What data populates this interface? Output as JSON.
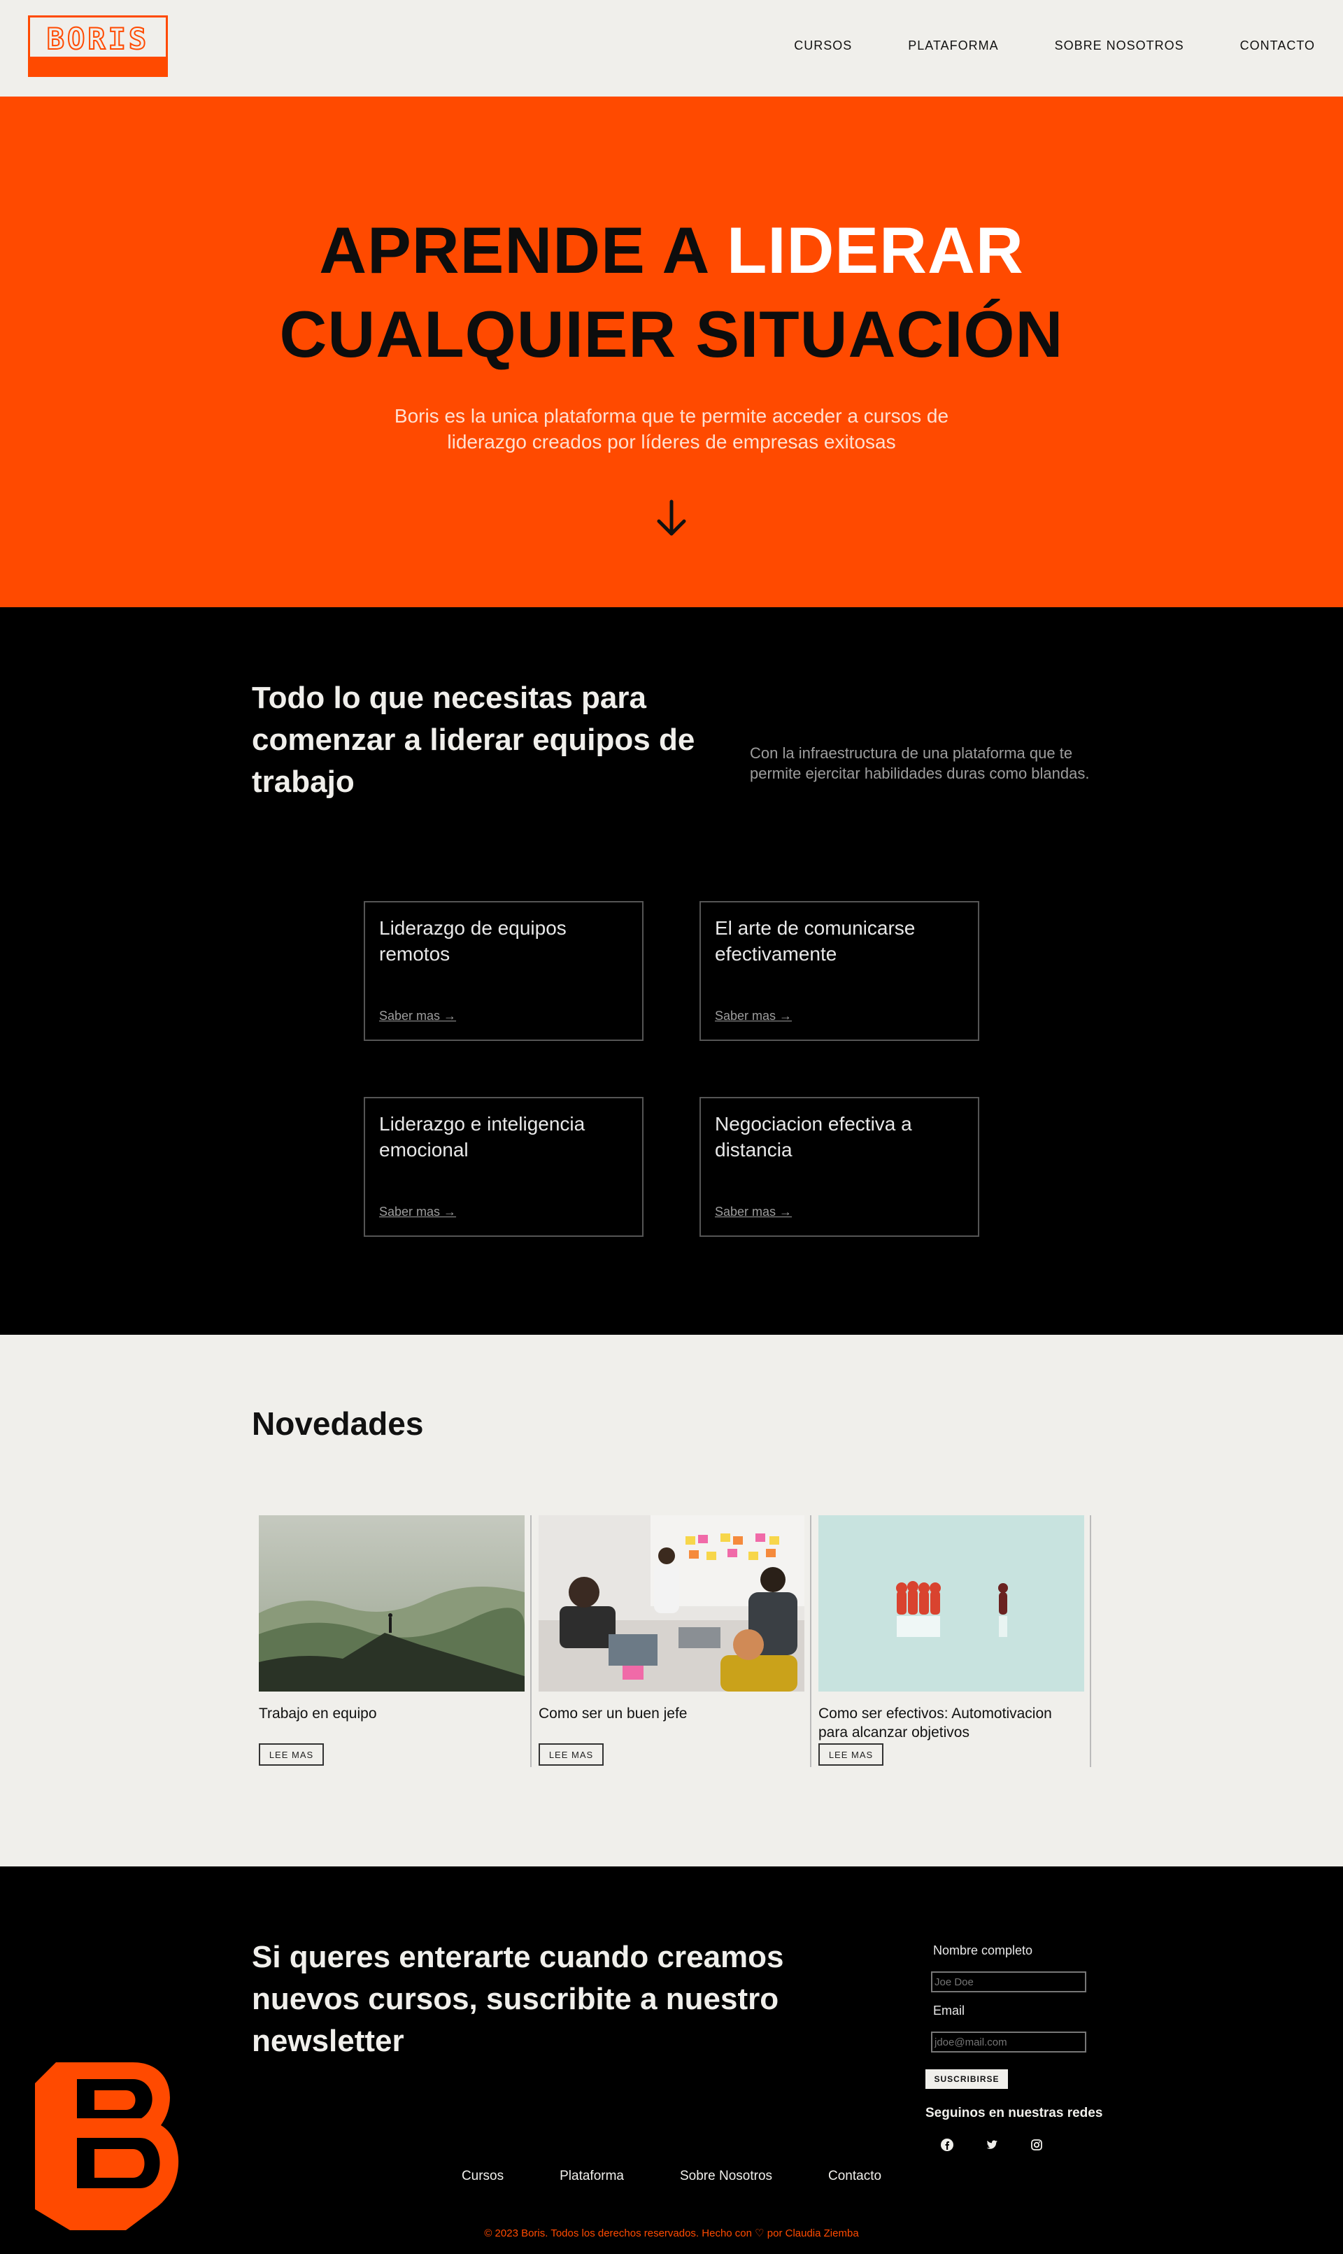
{
  "header": {
    "logo_text": "BORIS",
    "nav": [
      "CURSOS",
      "PLATAFORMA",
      "SOBRE NOSOTROS",
      "CONTACTO"
    ]
  },
  "hero": {
    "title_part1": "APRENDE A ",
    "title_highlight": "LIDERAR",
    "title_line2": "CUALQUIER SITUACIÓN",
    "subtitle": "Boris es la unica plataforma que te permite acceder a cursos de liderazgo creados por líderes de empresas exitosas",
    "arrow_icon": "arrow-down-icon"
  },
  "features": {
    "title": "Todo lo que necesitas para comenzar a liderar equipos de trabajo",
    "description": "Con la infraestructura de una plataforma que te permite ejercitar habilidades duras como blandas.",
    "cards": [
      {
        "title": "Liderazgo de equipos remotos",
        "link": "Saber mas →"
      },
      {
        "title": "El arte de comunicarse efectivamente",
        "link": "Saber mas →"
      },
      {
        "title": "Liderazgo e inteligencia emocional",
        "link": "Saber mas →"
      },
      {
        "title": "Negociacion efectiva a distancia",
        "link": "Saber mas →"
      }
    ]
  },
  "news": {
    "title": "Novedades",
    "items": [
      {
        "title": "Trabajo en equipo",
        "button": "LEE MAS"
      },
      {
        "title": "Como ser un buen jefe",
        "button": "LEE MAS"
      },
      {
        "title": "Como ser efectivos: Automotivacion para alcanzar objetivos",
        "button": "LEE MAS"
      }
    ]
  },
  "footer": {
    "newsletter_title": "Si queres enterarte cuando creamos nuevos cursos, suscribite a nuestro newsletter",
    "form": {
      "name_label": "Nombre completo",
      "name_placeholder": "Joe Doe",
      "email_label": "Email",
      "email_placeholder": "jdoe@mail.com",
      "submit": "SUSCRIBIRSE"
    },
    "social_title": "Seguinos en nuestras redes",
    "social_icons": [
      "facebook-icon",
      "twitter-icon",
      "instagram-icon"
    ],
    "nav": [
      "Cursos",
      "Plataforma",
      "Sobre Nosotros",
      "Contacto"
    ],
    "copyright": "© 2023 Boris. Todos los derechos reservados. Hecho con ♡ por Claudia Ziemba"
  },
  "colors": {
    "accent": "#ff4a00",
    "background": "#f0efeb",
    "dark": "#000000"
  }
}
